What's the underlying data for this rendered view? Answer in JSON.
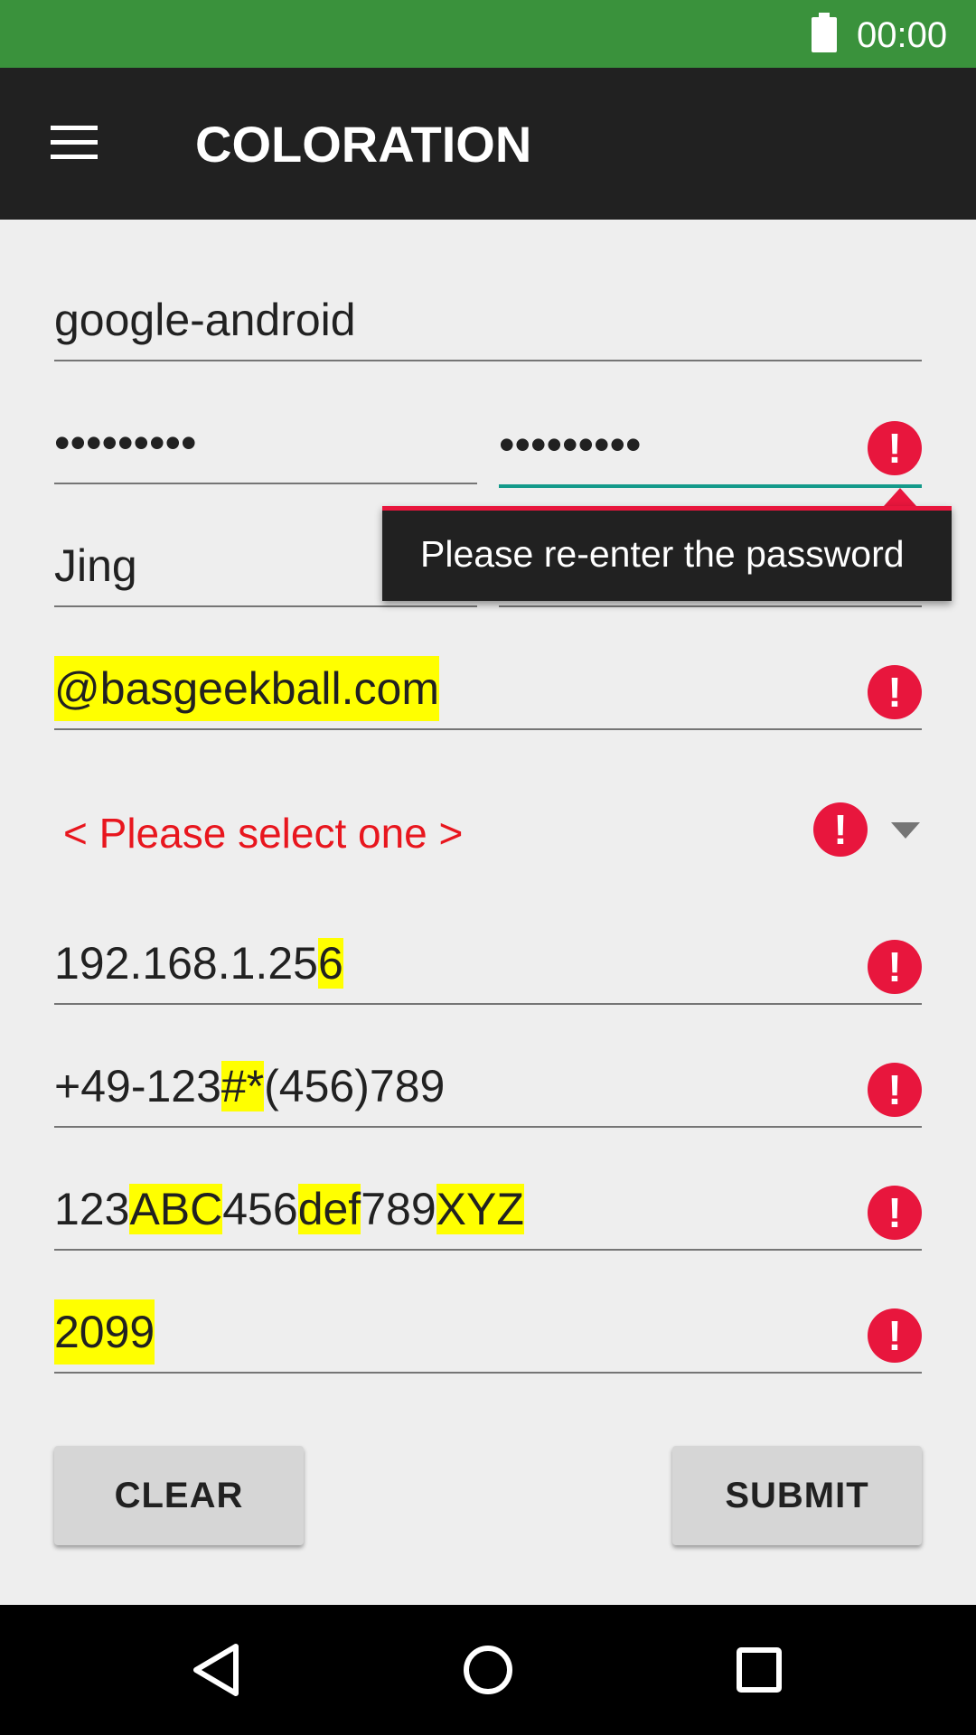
{
  "status_bar": {
    "time": "00:00",
    "icons": [
      "battery-icon"
    ]
  },
  "toolbar": {
    "title": "COLORATION",
    "menu_icon": "hamburger-menu-icon"
  },
  "form": {
    "username": "google-android",
    "password": "•••••••••",
    "password_confirm": "•••••••••",
    "first_name": "Jing",
    "email": "@basgeekball.com",
    "spinner_text": "< Please select one >",
    "ip_normal": "192.168.1.25",
    "ip_error": "6",
    "phone": {
      "a": "+49-123",
      "b": "#*",
      "c": "(456)789"
    },
    "alnum": {
      "a": "123",
      "b": "ABC",
      "c": "456",
      "d": "def",
      "e": "789",
      "f": "XYZ"
    },
    "year": "2099",
    "error_symbol": "!"
  },
  "tooltip": {
    "text": "Please re-enter the password"
  },
  "buttons": {
    "clear": "CLEAR",
    "submit": "SUBMIT"
  },
  "colors": {
    "status_bar": "#3a923c",
    "toolbar": "#212121",
    "error": "#e8163d",
    "highlight": "#ffff00",
    "focus_line": "#139a8a",
    "spinner_text": "#e8161e"
  }
}
